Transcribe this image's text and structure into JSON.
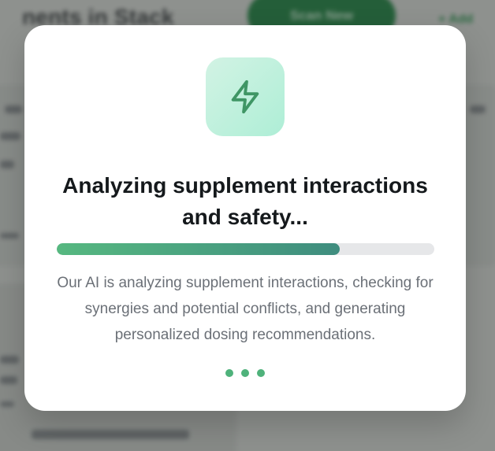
{
  "background": {
    "title": "nents in Stack",
    "scan_label": "Scan New",
    "add_label": "+ Add"
  },
  "modal": {
    "icon": "lightning-bolt-icon",
    "title": "Analyzing supplement interactions and safety...",
    "progress": 0.75,
    "description": "Our AI is analyzing supplement interactions, checking for synergies and potential conflicts, and generating personalized dosing recommendations.",
    "loading_dots": 3
  },
  "colors": {
    "accent": "#4fb27b",
    "accent_dark": "#3f8d7f",
    "icon_stroke": "#3f9665",
    "icon_tile": "#c3f2df",
    "title_text": "#15191c",
    "body_text": "#6b7077"
  }
}
